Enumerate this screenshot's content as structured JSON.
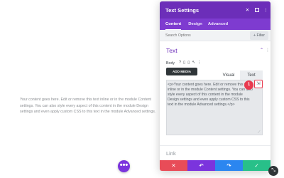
{
  "page": {
    "body_text": "Your content goes here. Edit or remove this text inline or in the module Content settings. You can also style every aspect of this content in the module Design settings and even apply custom CSS to this text in the module Advanced settings."
  },
  "modal": {
    "title": "Text Settings",
    "header_icons": [
      "close-icon",
      "snap-icon",
      "dots-icon"
    ],
    "tabs": [
      {
        "label": "Content",
        "active": true
      },
      {
        "label": "Design",
        "active": false
      },
      {
        "label": "Advanced",
        "active": false
      }
    ],
    "search": {
      "placeholder": "Search Options",
      "filter_label": "+ Filter"
    },
    "section": {
      "title": "Text",
      "field_label": "Body",
      "field_icons": [
        "?",
        "▯",
        "▯",
        "↖",
        "⋮"
      ],
      "add_media_label": "ADD MEDIA",
      "editor_tabs": [
        "Visual",
        "Text"
      ],
      "editor_content": "<p>Your content goes here. Edit or remove this text inline or in the module Content settings. You can also style every aspect of this content in the module Design settings and even apply custom CSS to this text in the module Advanced settings.</p>",
      "badge": "1"
    },
    "collapsed_section": "Link",
    "footer": [
      {
        "name": "cancel",
        "glyph": "✕",
        "color": "#e84c58"
      },
      {
        "name": "undo",
        "glyph": "↶",
        "color": "#7b34dd"
      },
      {
        "name": "redo",
        "glyph": "↷",
        "color": "#2b86f0"
      },
      {
        "name": "save",
        "glyph": "✓",
        "color": "#28c089"
      }
    ]
  },
  "colors": {
    "header": "#6c2eb9",
    "tabs": "#7e3bd0",
    "badge": "#e93a4f"
  }
}
